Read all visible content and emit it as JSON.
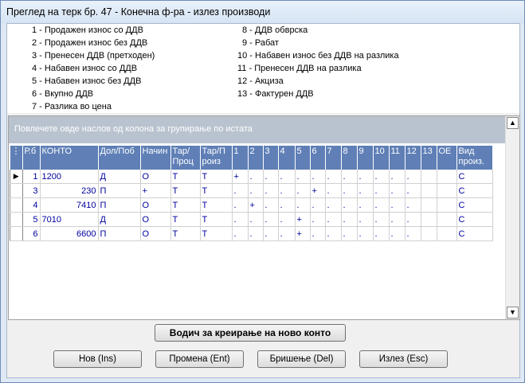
{
  "window": {
    "title": "Преглед на терк бр. 47 - Конечна ф-ра - излез производи"
  },
  "legend": {
    "left": [
      "1 - Продажен износ со ДДВ",
      "2 - Продажен износ без ДДВ",
      "3 - Пренесен ДДВ (претходен)",
      "4 - Набавен износ со ДДВ",
      "5 - Набавен износ без ДДВ",
      "6 - Вкупно ДДВ",
      "7 - Разлика во цена"
    ],
    "right": [
      "8 - ДДВ обврска",
      "9 - Рабат",
      "10 - Набавен износ без ДДВ на разлика",
      "11 - Пренесен ДДВ на разлика",
      "12 - Акциза",
      "13 - Фактурен ДДВ"
    ]
  },
  "grid": {
    "group_panel_text": "Повлечете овде наслов од колона за групирање по истата",
    "row_selector_header": "⋮",
    "columns": [
      "Р.б",
      "КОНТО",
      "Дол/Поб",
      "Начин",
      "Тар/ Проц",
      "Тар/П роиз",
      "1",
      "2",
      "3",
      "4",
      "5",
      "6",
      "7",
      "8",
      "9",
      "10",
      "11",
      "12",
      "13",
      "ОЕ",
      "Вид произ."
    ],
    "rows": [
      {
        "rb": "1",
        "konto": "1200",
        "dolpob": "Д",
        "nacin": "О",
        "tarproc": "Т",
        "tarproiz": "Т",
        "c": [
          "+",
          ".",
          ".",
          ".",
          ".",
          ".",
          ".",
          ".",
          ".",
          ".",
          ".",
          ".",
          ""
        ],
        "oe": "",
        "vid": "С"
      },
      {
        "rb": "3",
        "konto": "230",
        "dolpob": "П",
        "nacin": "+",
        "tarproc": "Т",
        "tarproiz": "Т",
        "c": [
          ".",
          ".",
          ".",
          ".",
          ".",
          "+",
          ".",
          ".",
          ".",
          ".",
          ".",
          ".",
          ""
        ],
        "oe": "",
        "vid": "С"
      },
      {
        "rb": "4",
        "konto": "7410",
        "dolpob": "П",
        "nacin": "О",
        "tarproc": "Т",
        "tarproiz": "Т",
        "c": [
          ".",
          "+",
          ".",
          ".",
          ".",
          ".",
          ".",
          ".",
          ".",
          ".",
          ".",
          ".",
          ""
        ],
        "oe": "",
        "vid": "С"
      },
      {
        "rb": "5",
        "konto": "7010",
        "dolpob": "Д",
        "nacin": "О",
        "tarproc": "Т",
        "tarproiz": "Т",
        "c": [
          ".",
          ".",
          ".",
          ".",
          "+",
          ".",
          ".",
          ".",
          ".",
          ".",
          ".",
          ".",
          ""
        ],
        "oe": "",
        "vid": "С"
      },
      {
        "rb": "6",
        "konto": "6600",
        "dolpob": "П",
        "nacin": "О",
        "tarproc": "Т",
        "tarproiz": "Т",
        "c": [
          ".",
          ".",
          ".",
          ".",
          "+",
          ".",
          ".",
          ".",
          ".",
          ".",
          ".",
          ".",
          ""
        ],
        "oe": "",
        "vid": "С"
      }
    ]
  },
  "buttons": {
    "wizard": "Водич за креирање на ново конто",
    "new": "Нов (Ins)",
    "edit": "Промена (Ent)",
    "delete": "Бришење (Del)",
    "exit": "Излез (Esc)"
  },
  "colors": {
    "header_bg": "#5f7fb6",
    "group_panel_bg": "#b9c3cf",
    "cell_text": "#0000a0"
  }
}
